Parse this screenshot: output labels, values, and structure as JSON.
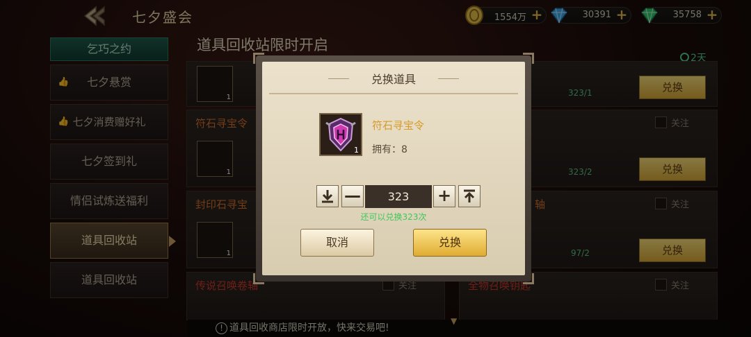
{
  "header": {
    "title": "七夕盛会",
    "currencies": [
      {
        "name": "gold",
        "value": "1554万",
        "color": "#e8c04a"
      },
      {
        "name": "diamond-blue",
        "value": "30391",
        "color": "#3aa8e8"
      },
      {
        "name": "diamond-green",
        "value": "35758",
        "color": "#2ec86a"
      }
    ],
    "plus_label": "+"
  },
  "sidebar": {
    "tab_head": "乞巧之约",
    "items": [
      {
        "label": "七夕悬赏",
        "thumb": "👍"
      },
      {
        "label": "七夕消费赠好礼",
        "thumb": "👍"
      },
      {
        "label": "七夕签到礼",
        "thumb": ""
      },
      {
        "label": "情侣试炼送福利",
        "thumb": ""
      },
      {
        "label": "道具回收站",
        "thumb": ""
      },
      {
        "label": "道具回收站",
        "thumb": ""
      }
    ]
  },
  "main": {
    "title": "道具回收站限时开启",
    "days_left": "2天",
    "cards": [
      {
        "name": "",
        "slot1_count": "1",
        "progress": "323/1",
        "button": "兑换",
        "follow": ""
      },
      {
        "name": "符石寻宝令",
        "slot1_count": "1",
        "progress": "323/2",
        "button": "兑换",
        "follow": "关注"
      },
      {
        "name": "封印石寻宝",
        "slot1_count": "1",
        "progress": "97/2",
        "button": "兑换",
        "follow": "关注"
      },
      {
        "name": "传说召唤卷轴",
        "follow": "关注"
      },
      {
        "name": "全物召唤钥匙",
        "follow": "关注"
      }
    ],
    "right_card_partial_names": [
      "轴"
    ],
    "equals": "=",
    "bottom_tip": "道具回收商店限时开放，快来交易吧!",
    "tip_icon": "!"
  },
  "dialog": {
    "title": "兑换道具",
    "item_name": "符石寻宝令",
    "item_count": "1",
    "own_label": "拥有：8",
    "quantity": "323",
    "min_label": "⤓",
    "minus_label": "—",
    "plus_label": "+",
    "max_label": "⤒",
    "avail_text": "还可以兑换323次",
    "cancel_label": "取消",
    "confirm_label": "兑换"
  }
}
